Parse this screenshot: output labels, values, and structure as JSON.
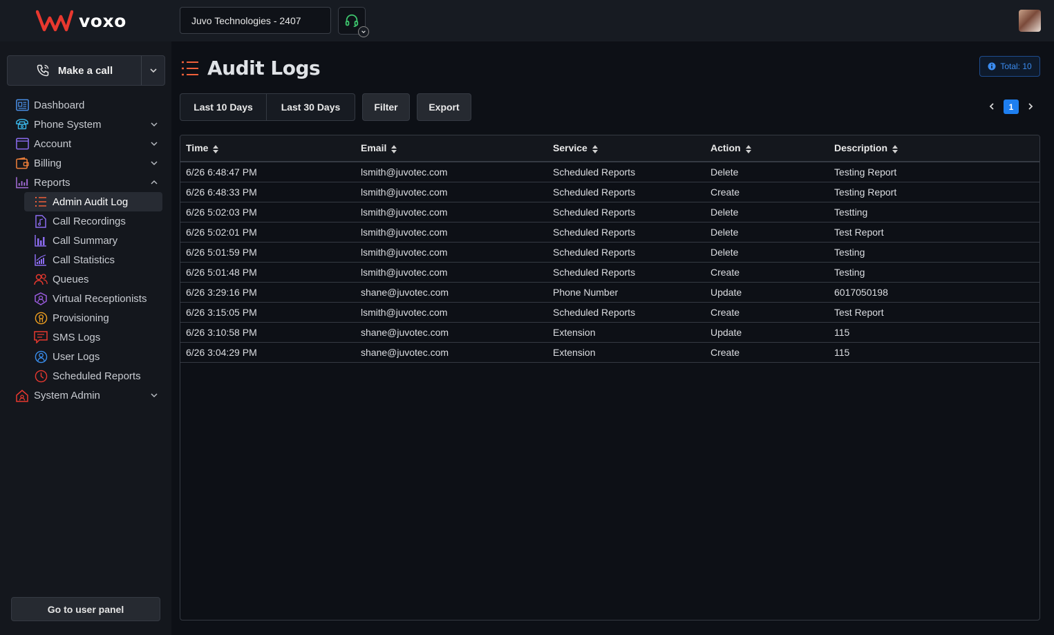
{
  "app": {
    "brand": "voxo"
  },
  "topbar": {
    "company": "Juvo Technologies - 2407",
    "headset_icon": "headset-icon",
    "avatar": "user-avatar"
  },
  "sidebar": {
    "make_call_label": "Make a call",
    "items": [
      {
        "label": "Dashboard",
        "icon": "dashboard-icon",
        "expandable": false
      },
      {
        "label": "Phone System",
        "icon": "phone-icon",
        "expandable": true
      },
      {
        "label": "Account",
        "icon": "account-icon",
        "expandable": true
      },
      {
        "label": "Billing",
        "icon": "wallet-icon",
        "expandable": true
      },
      {
        "label": "Reports",
        "icon": "chart-icon",
        "expandable": true,
        "expanded": true
      }
    ],
    "reports_sub": [
      {
        "label": "Admin Audit Log",
        "icon": "list-icon",
        "active": true
      },
      {
        "label": "Call Recordings",
        "icon": "audio-file-icon"
      },
      {
        "label": "Call Summary",
        "icon": "bar-chart-icon"
      },
      {
        "label": "Call Statistics",
        "icon": "stats-icon"
      },
      {
        "label": "Queues",
        "icon": "people-icon"
      },
      {
        "label": "Virtual Receptionists",
        "icon": "receptionist-icon"
      },
      {
        "label": "Provisioning",
        "icon": "provisioning-icon"
      },
      {
        "label": "SMS Logs",
        "icon": "message-icon"
      },
      {
        "label": "User Logs",
        "icon": "user-icon"
      },
      {
        "label": "Scheduled Reports",
        "icon": "clock-icon"
      }
    ],
    "system_admin": "System Admin",
    "user_panel": "Go to user panel"
  },
  "main": {
    "title": "Audit Logs",
    "total": "Total: 10",
    "buttons": {
      "last10": "Last 10 Days",
      "last30": "Last 30 Days",
      "filter": "Filter",
      "export": "Export"
    },
    "pagination": {
      "current": "1"
    },
    "table": {
      "headers": [
        "Time",
        "Email",
        "Service",
        "Action",
        "Description"
      ],
      "rows": [
        [
          "6/26 6:48:47 PM",
          "lsmith@juvotec.com",
          "Scheduled Reports",
          "Delete",
          "Testing Report"
        ],
        [
          "6/26 6:48:33 PM",
          "lsmith@juvotec.com",
          "Scheduled Reports",
          "Create",
          "Testing Report"
        ],
        [
          "6/26 5:02:03 PM",
          "lsmith@juvotec.com",
          "Scheduled Reports",
          "Delete",
          "Testting"
        ],
        [
          "6/26 5:02:01 PM",
          "lsmith@juvotec.com",
          "Scheduled Reports",
          "Delete",
          "Test Report"
        ],
        [
          "6/26 5:01:59 PM",
          "lsmith@juvotec.com",
          "Scheduled Reports",
          "Delete",
          "Testing"
        ],
        [
          "6/26 5:01:48 PM",
          "lsmith@juvotec.com",
          "Scheduled Reports",
          "Create",
          "Testing"
        ],
        [
          "6/26 3:29:16 PM",
          "shane@juvotec.com",
          "Phone Number",
          "Update",
          "6017050198"
        ],
        [
          "6/26 3:15:05 PM",
          "lsmith@juvotec.com",
          "Scheduled Reports",
          "Create",
          "Test Report"
        ],
        [
          "6/26 3:10:58 PM",
          "shane@juvotec.com",
          "Extension",
          "Update",
          "115"
        ],
        [
          "6/26 3:04:29 PM",
          "shane@juvotec.com",
          "Extension",
          "Create",
          "115"
        ]
      ]
    }
  },
  "colors": {
    "accent": "#1e7ff0",
    "brand_red": "#e8382f",
    "background": "#0d1016"
  }
}
